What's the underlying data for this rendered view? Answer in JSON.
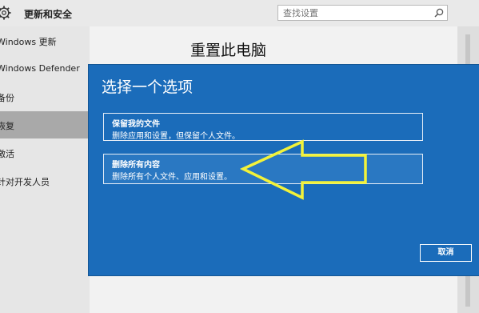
{
  "app": {
    "title": "更新和安全"
  },
  "search": {
    "placeholder": "查找设置"
  },
  "sidebar": {
    "items": [
      {
        "label": "Windows 更新"
      },
      {
        "label": "Windows Defender"
      },
      {
        "label": "备份"
      },
      {
        "label": "恢复"
      },
      {
        "label": "激活"
      },
      {
        "label": "针对开发人员"
      }
    ],
    "active_index": 3
  },
  "content": {
    "title": "重置此电脑"
  },
  "dialog": {
    "title": "选择一个选项",
    "options": [
      {
        "title": "保留我的文件",
        "description": "删除应用和设置，但保留个人文件。"
      },
      {
        "title": "删除所有内容",
        "description": "删除所有个人文件、应用和设置。"
      }
    ],
    "cancel_label": "取消"
  },
  "colors": {
    "dialog_background": "#1b6cba",
    "annotation_arrow": "#f2f23a"
  },
  "icons": {
    "settings": "gear-icon",
    "search": "search-icon"
  }
}
